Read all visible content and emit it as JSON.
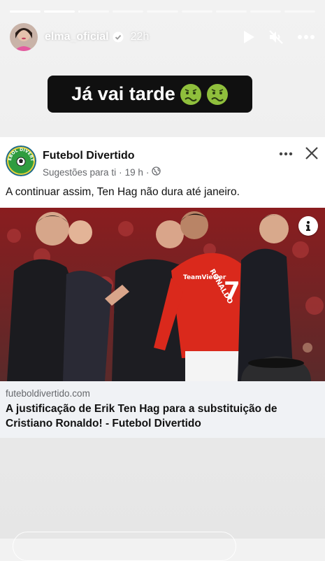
{
  "story": {
    "segments": [
      1,
      1,
      0.05,
      0,
      0,
      0,
      0,
      0,
      0
    ],
    "username": "elma_oficial",
    "time": "22h",
    "caption": "Já vai tarde",
    "caption_emojis": [
      "nauseated-face",
      "nauseated-face"
    ]
  },
  "controls": {
    "icons": [
      "play-icon",
      "mute-icon",
      "more-icon"
    ]
  },
  "post": {
    "page_name": "Futebol Divertido",
    "meta_label": "Sugestões para ti",
    "meta_time": "19 h",
    "meta_separator": "·",
    "meta_dot": "·",
    "text": "A continuar assim, Ten Hag não dura até janeiro.",
    "logo_text": "FUTEBOL DIVERTIDO",
    "link_domain": "futeboldivertido.com",
    "link_title": "A justificação de Erik Ten Hag para a substituição de Cristiano Ronaldo! - Futebol Divertido",
    "jersey_number": "7",
    "jersey_name": "RONALDO",
    "jersey_sponsor": "TeamViewer"
  },
  "colors": {
    "caption_bg": "#101010",
    "meta": "#65676b",
    "link_bg": "#f0f2f5",
    "jersey_red": "#da291c"
  }
}
